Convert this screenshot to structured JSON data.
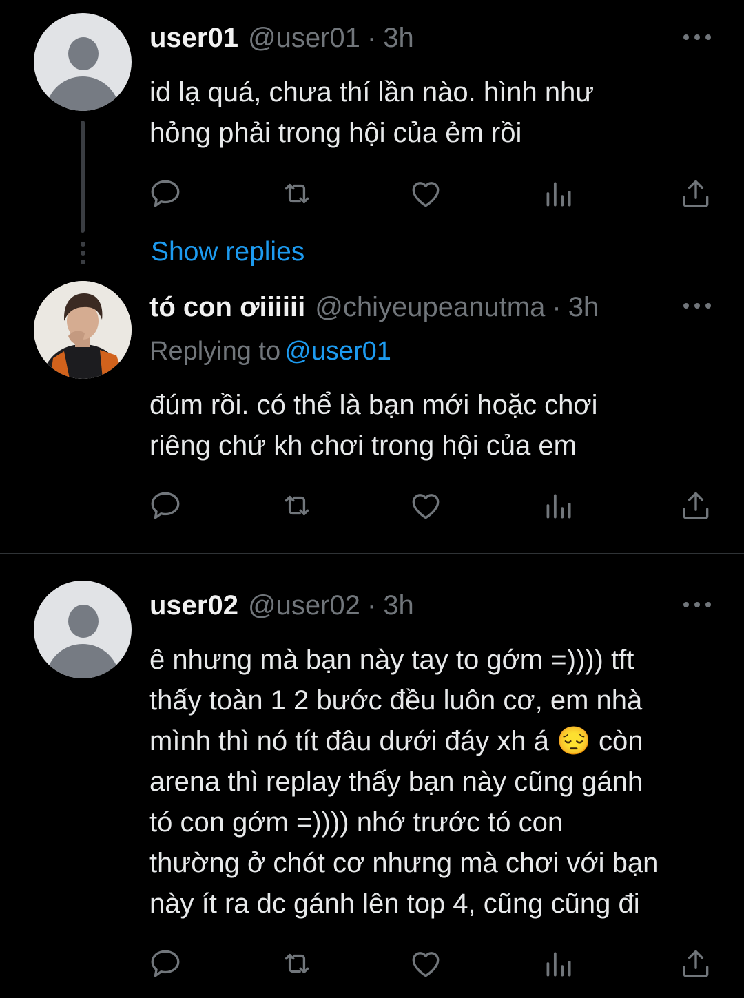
{
  "tweets": [
    {
      "name": "user01",
      "handle": "@user01",
      "separator": "·",
      "time": "3h",
      "text": "id lạ quá, chưa thí lần nào. hình như\nhỏng phải trong hội của ẻm rồi"
    },
    {
      "name": "tó con ơiiiiii",
      "handle": "@chiyeupeanutma",
      "separator": "·",
      "time": "3h",
      "replying_label": "Replying to",
      "replying_to": "@user01",
      "text": "đúm rồi. có thể là bạn mới hoặc chơi\nriêng chứ kh chơi trong hội của em"
    },
    {
      "name": "user02",
      "handle": "@user02",
      "separator": "·",
      "time": "3h",
      "text": "ê nhưng mà bạn này tay to gớm =)))) tft\nthấy toàn 1 2 bước đều luôn cơ, em nhà\nmình thì nó tít đâu dưới đáy xh á 😔 còn\narena thì replay thấy bạn này cũng gánh\ntó con gớm =)))) nhớ trước tó con\nthường ở chót cơ nhưng mà chơi với bạn\nnày ít ra dc gánh lên top 4, cũng cũng đi"
    }
  ],
  "show_replies": "Show replies",
  "icons": [
    "reply-icon",
    "retweet-icon",
    "like-icon",
    "analytics-icon",
    "share-icon",
    "more-icon",
    "avatar-icon"
  ],
  "colors": {
    "background": "#000000",
    "text": "#e7e9ea",
    "muted": "#71767b",
    "accent": "#1d9bf0",
    "divider": "#2f3336"
  }
}
